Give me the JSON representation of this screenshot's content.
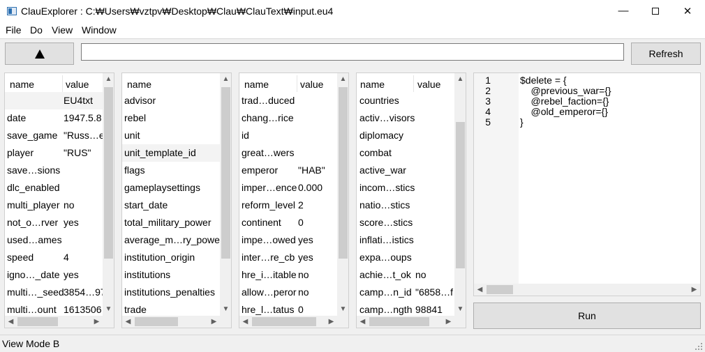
{
  "window": {
    "title": "ClauExplorer : C:₩Users₩vztpv₩Desktop₩Clau₩ClauText₩input.eu4",
    "minimize": "—",
    "close": "✕"
  },
  "menu": {
    "file": "File",
    "do": "Do",
    "view": "View",
    "window": "Window"
  },
  "toolbar": {
    "path_value": "",
    "refresh_label": "Refresh"
  },
  "panels": [
    {
      "header_name": "name",
      "header_value": "value",
      "rows": [
        {
          "name": "",
          "value": "EU4txt"
        },
        {
          "name": "date",
          "value": "1947.5.8"
        },
        {
          "name": "save_game",
          "value": "\"Russ…eu"
        },
        {
          "name": "player",
          "value": "\"RUS\""
        },
        {
          "name": "save…sions",
          "value": ""
        },
        {
          "name": "dlc_enabled",
          "value": ""
        },
        {
          "name": "multi_player",
          "value": "no"
        },
        {
          "name": "not_o…rver",
          "value": "yes"
        },
        {
          "name": "used…ames",
          "value": ""
        },
        {
          "name": "speed",
          "value": "4"
        },
        {
          "name": "igno…_date",
          "value": "yes"
        },
        {
          "name": "multi…_seed",
          "value": "3854…97"
        },
        {
          "name": "multi…ount",
          "value": "1613506"
        }
      ]
    },
    {
      "header_name": "name",
      "rows": [
        {
          "name": "advisor"
        },
        {
          "name": "rebel"
        },
        {
          "name": "unit"
        },
        {
          "name": "unit_template_id"
        },
        {
          "name": "flags"
        },
        {
          "name": "gameplaysettings"
        },
        {
          "name": "start_date"
        },
        {
          "name": "total_military_power"
        },
        {
          "name": "average_m…ry_power"
        },
        {
          "name": "institution_origin"
        },
        {
          "name": "institutions"
        },
        {
          "name": "institutions_penalties"
        },
        {
          "name": "trade"
        }
      ]
    },
    {
      "header_name": "name",
      "header_value": "value",
      "rows": [
        {
          "name": "trad…duced",
          "value": ""
        },
        {
          "name": "chang…rice",
          "value": ""
        },
        {
          "name": "id",
          "value": ""
        },
        {
          "name": "great…wers",
          "value": ""
        },
        {
          "name": "emperor",
          "value": "\"HAB\""
        },
        {
          "name": "imper…ence",
          "value": "0.000"
        },
        {
          "name": "reform_level",
          "value": "2"
        },
        {
          "name": "continent",
          "value": "0"
        },
        {
          "name": "impe…owed",
          "value": "yes"
        },
        {
          "name": "inter…re_cb",
          "value": "yes"
        },
        {
          "name": "hre_i…itable",
          "value": "no"
        },
        {
          "name": "allow…peror",
          "value": "no"
        },
        {
          "name": "hre_l…tatus",
          "value": "0"
        }
      ]
    },
    {
      "header_name": "name",
      "header_value": "value",
      "rows": [
        {
          "name": "countries",
          "value": ""
        },
        {
          "name": "activ…visors",
          "value": ""
        },
        {
          "name": "diplomacy",
          "value": ""
        },
        {
          "name": "combat",
          "value": ""
        },
        {
          "name": "active_war",
          "value": ""
        },
        {
          "name": "incom…stics",
          "value": ""
        },
        {
          "name": "natio…stics",
          "value": ""
        },
        {
          "name": "score…stics",
          "value": ""
        },
        {
          "name": "inflati…istics",
          "value": ""
        },
        {
          "name": "expa…oups",
          "value": ""
        },
        {
          "name": "achie…t_ok",
          "value": "no"
        },
        {
          "name": "camp…n_id",
          "value": "\"6858…f"
        },
        {
          "name": "camp…ngth",
          "value": "98841"
        }
      ]
    }
  ],
  "editor": {
    "line_numbers": [
      "1",
      "2",
      "3",
      "4",
      "5"
    ],
    "lines": [
      "$delete = {",
      "    @previous_war={}",
      "    @rebel_faction={}",
      "    @old_emperor={}",
      "}"
    ]
  },
  "run_label": "Run",
  "status": {
    "text": "View Mode B"
  },
  "icons": {
    "scroll_up": "▲",
    "scroll_down": "▼",
    "scroll_left": "◀",
    "scroll_right": "▶",
    "up_arrow": "up-arrow"
  },
  "colors": {
    "selection": "#f3f3f3",
    "scroll_thumb": "#cdcdcd",
    "button_face": "#e1e1e1"
  }
}
